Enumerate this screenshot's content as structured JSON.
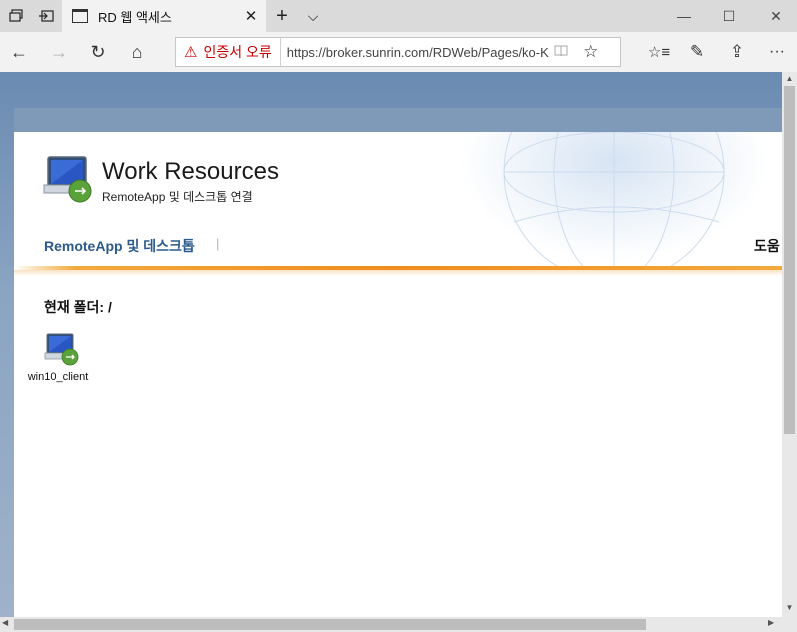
{
  "browser": {
    "tab_title": "RD 웹 액세스",
    "tab_close_glyph": "✕",
    "new_tab_glyph": "+",
    "tab_menu_glyph": "⌵",
    "cert_warning": "인증서 오류",
    "url": "https://broker.sunrin.com/RDWeb/Pages/ko-KR/Default.aspx",
    "window_controls": {
      "minimize": "—",
      "maximize": "☐",
      "close": "✕"
    },
    "nav_glyphs": {
      "back": "←",
      "forward": "→",
      "refresh": "↻",
      "home": "⌂"
    },
    "toolbar_glyphs": {
      "favorite": "☆",
      "favorites_hub": "☆≡",
      "notes": "✎",
      "share": "⇪",
      "more": "···"
    }
  },
  "page": {
    "title": "Work Resources",
    "subtitle": "RemoteApp 및 데스크톱 연결",
    "nav_remoteapp": "RemoteApp 및 데스크톱",
    "nav_separator": "|",
    "nav_help": "도움",
    "current_folder": "현재 폴더: /",
    "resources": [
      {
        "label": "win10_client",
        "icon": "remote-desktop-icon"
      }
    ]
  },
  "colors": {
    "link_blue": "#2c5a8c",
    "cert_red": "#c80000",
    "accent_orange": "#f08c1c",
    "page_background": "#7f9ab8"
  }
}
